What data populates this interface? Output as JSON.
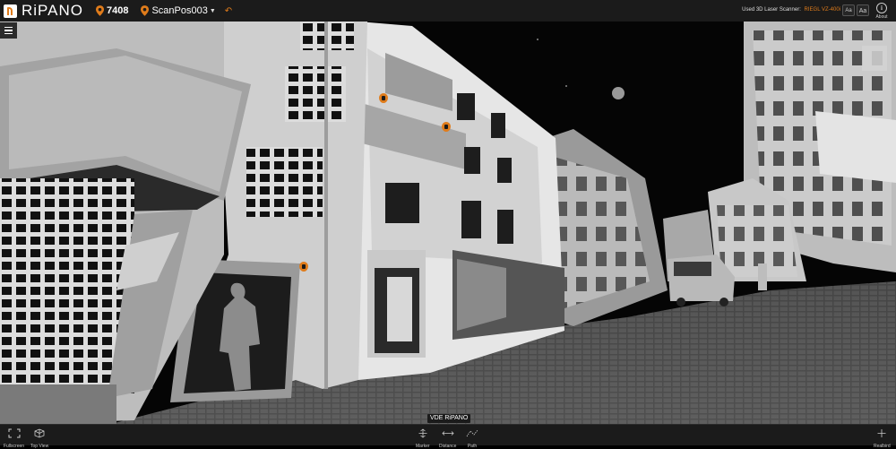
{
  "app": {
    "logo_text": "RiPANO",
    "scan_count": "7408",
    "scan_position": "ScanPos003"
  },
  "scanner": {
    "label": "Used 3D Laser Scanner:",
    "model": "RIEGL VZ-400i"
  },
  "header_buttons": {
    "font_small": "Aa",
    "font_large": "Aa",
    "about_label": "About"
  },
  "watermark": "VDE RiPANO",
  "toolbar": {
    "fullscreen": "Fullscreen",
    "top_view": "Top View",
    "marker": "Marker",
    "distance": "Distance",
    "path": "Path",
    "realbird": "Realbird"
  },
  "icons": [
    "menu-icon",
    "location-pin-icon",
    "undo-icon",
    "info-icon",
    "fullscreen-icon",
    "top-view-icon",
    "marker-icon",
    "distance-icon",
    "path-icon",
    "realbird-icon"
  ],
  "colors": {
    "accent": "#e07c1b",
    "bar": "#1b1b1b"
  }
}
